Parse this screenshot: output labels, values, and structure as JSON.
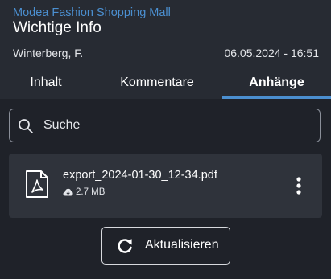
{
  "header": {
    "company": "Modea Fashion Shopping Mall",
    "title": "Wichtige Info",
    "author": "Winterberg, F.",
    "datetime": "06.05.2024 - 16:51"
  },
  "tabs": [
    {
      "label": "Inhalt",
      "active": false
    },
    {
      "label": "Kommentare",
      "active": false
    },
    {
      "label": "Anhänge",
      "active": true
    }
  ],
  "search": {
    "placeholder": "Suche",
    "value": ""
  },
  "attachments": [
    {
      "name": "export_2024-01-30_12-34.pdf",
      "size": "2.7 MB",
      "icon": "pdf-file-icon"
    }
  ],
  "refresh_button": {
    "label": "Aktualisieren",
    "icon": "refresh-icon"
  },
  "colors": {
    "accent": "#4b8fd0",
    "background": "#1f2229",
    "header": "#272b33",
    "card": "#2f333b"
  }
}
